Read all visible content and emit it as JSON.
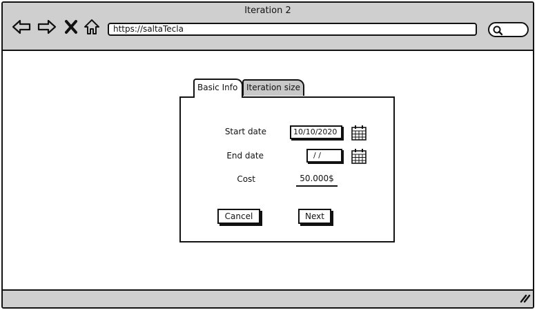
{
  "window": {
    "title": "Iteration 2",
    "url": "https://saltaTecla"
  },
  "nav": {
    "back_icon": "arrow-left-icon",
    "forward_icon": "arrow-right-icon",
    "stop_icon": "close-icon",
    "home_icon": "home-icon",
    "search_icon": "search-icon"
  },
  "tabs": [
    {
      "label": "Basic Info",
      "active": true
    },
    {
      "label": "Iteration size",
      "active": false
    }
  ],
  "form": {
    "start_date_label": "Start date",
    "start_date_value": "10/10/2020",
    "end_date_label": "End date",
    "end_date_value": "/ /",
    "cost_label": "Cost",
    "cost_value": "50.000$"
  },
  "buttons": {
    "cancel": "Cancel",
    "next": "Next"
  },
  "colors": {
    "chrome": "#cfcfcf",
    "inactive_tab": "#c8c8c8",
    "stroke": "#111111"
  }
}
